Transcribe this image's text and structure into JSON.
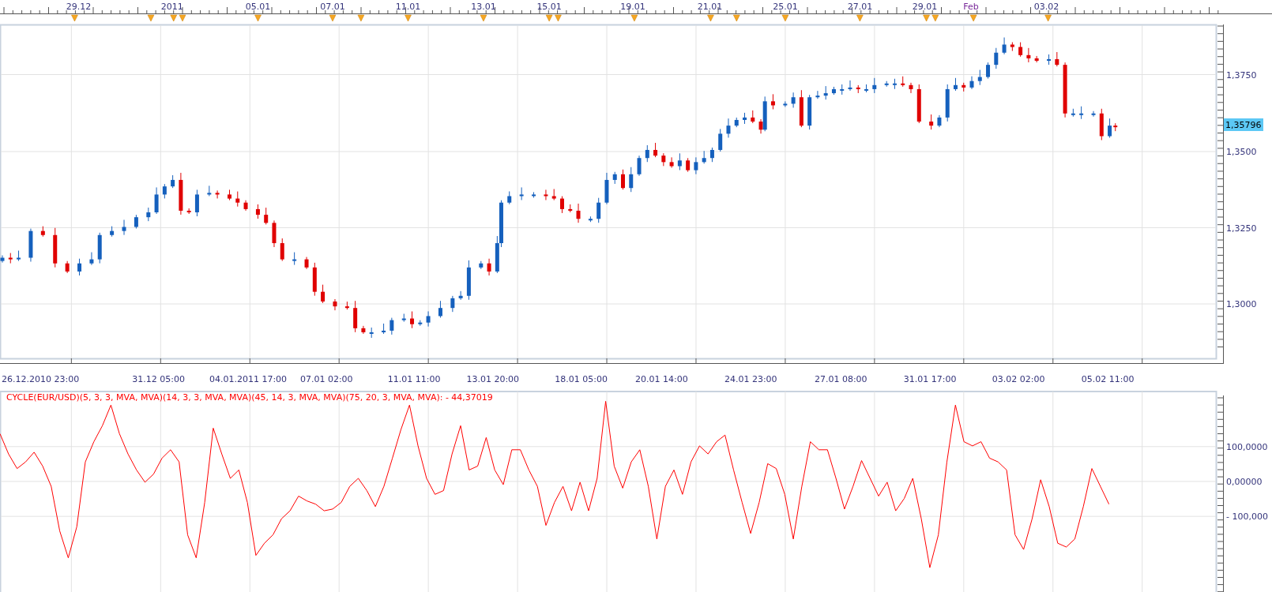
{
  "top_axis": {
    "labels": [
      {
        "text": "29.12",
        "kind": "day"
      },
      {
        "text": "2011",
        "kind": "day"
      },
      {
        "text": "05.01",
        "kind": "day"
      },
      {
        "text": "07.01",
        "kind": "day"
      },
      {
        "text": "11.01",
        "kind": "day"
      },
      {
        "text": "13.01",
        "kind": "day"
      },
      {
        "text": "15.01",
        "kind": "day"
      },
      {
        "text": "19.01",
        "kind": "day"
      },
      {
        "text": "21.01",
        "kind": "day"
      },
      {
        "text": "25.01",
        "kind": "day"
      },
      {
        "text": "27.01",
        "kind": "day"
      },
      {
        "text": "29.01",
        "kind": "day"
      },
      {
        "text": "Feb",
        "kind": "month"
      },
      {
        "text": "03.02",
        "kind": "day"
      }
    ]
  },
  "price_panel": {
    "y_axis_labels": [
      "1,3750",
      "1,3500",
      "1,3250",
      "1,3000"
    ],
    "last_price": "1,35796"
  },
  "time_axis": {
    "labels": [
      "26.12.2010 23:00",
      "31.12 05:00",
      "04.01.2011 17:00",
      "07.01 02:00",
      "11.01 11:00",
      "13.01 20:00",
      "18.01 05:00",
      "20.01 14:00",
      "24.01 23:00",
      "27.01 08:00",
      "31.01 17:00",
      "03.02 02:00",
      "05.02 11:00"
    ]
  },
  "indicator_panel": {
    "title": "CYCLE(EUR/USD)(5, 3, 3, MVA, MVA)(14, 3, 3, MVA, MVA)(45, 14, 3, MVA, MVA)(75, 20, 3, MVA, MVA): - 44,37019",
    "y_axis_labels": [
      "100,0000",
      "0,00000",
      "- 100,000"
    ]
  }
}
